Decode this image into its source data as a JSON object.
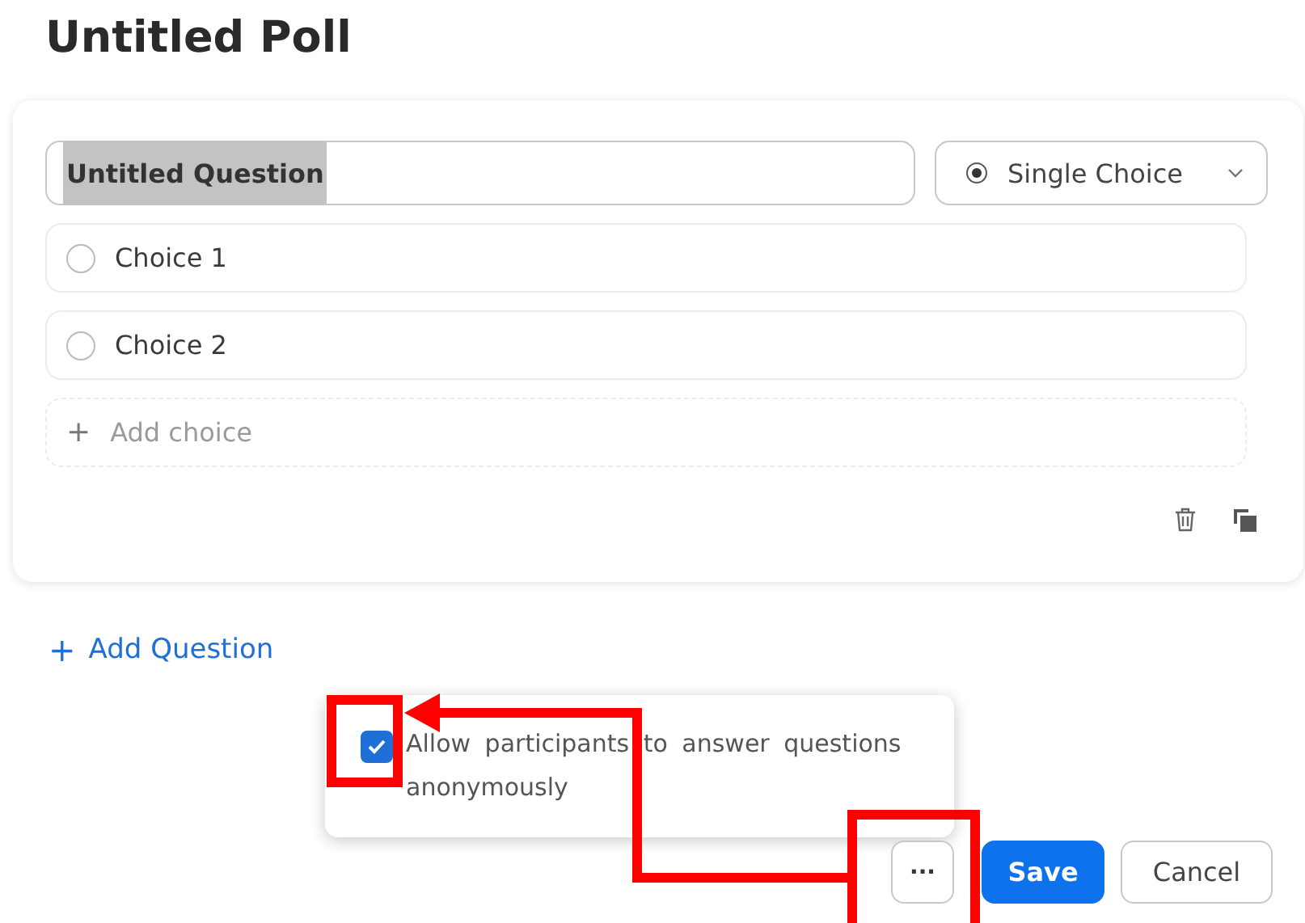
{
  "title": "Untitled Poll",
  "question": {
    "value": "Untitled Question",
    "text_selected": true,
    "type_select": {
      "label": "Single Choice"
    }
  },
  "choices": [
    {
      "kind": "choice",
      "label": "Choice 1",
      "selected": false
    },
    {
      "kind": "choice",
      "label": "Choice 2",
      "selected": false
    },
    {
      "kind": "add",
      "label": "Add choice",
      "icon": "+"
    }
  ],
  "add_question": {
    "icon": "+",
    "label": "Add Question"
  },
  "popup": {
    "options": [
      {
        "label": "Allow participants to answer questions anonymously",
        "checked": true
      }
    ]
  },
  "buttons": [
    {
      "kind": "more",
      "label": "···"
    },
    {
      "kind": "primary",
      "label": "Save"
    },
    {
      "kind": "secondary",
      "label": "Cancel"
    }
  ],
  "annotations": {
    "show": true
  }
}
